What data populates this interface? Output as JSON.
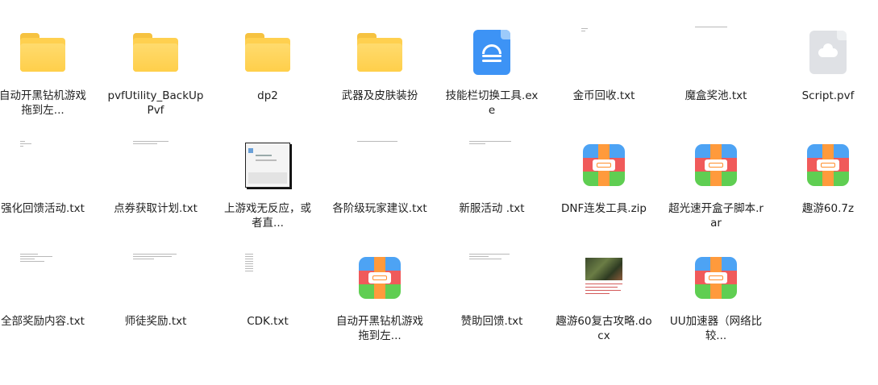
{
  "items": [
    {
      "name": "自动开黑钻机游戏拖到左...",
      "type": "folder"
    },
    {
      "name": "pvfUtility_BackUpPvf",
      "type": "folder"
    },
    {
      "name": "dp2",
      "type": "folder"
    },
    {
      "name": "武器及皮肤装扮",
      "type": "folder"
    },
    {
      "name": "技能栏切换工具.exe",
      "type": "exe"
    },
    {
      "name": "金币回收.txt",
      "type": "txt"
    },
    {
      "name": "魔盒奖池.txt",
      "type": "txt"
    },
    {
      "name": "Script.pvf",
      "type": "unknown"
    },
    {
      "name": "强化回馈活动.txt",
      "type": "txt"
    },
    {
      "name": "点券获取计划.txt",
      "type": "txt"
    },
    {
      "name": "上游戏无反应，或者直...",
      "type": "image"
    },
    {
      "name": "各阶级玩家建议.txt",
      "type": "txt"
    },
    {
      "name": "新服活动 .txt",
      "type": "txt"
    },
    {
      "name": "DNF连发工具.zip",
      "type": "archive"
    },
    {
      "name": "超光速开盒子脚本.rar",
      "type": "archive"
    },
    {
      "name": "趣游60.7z",
      "type": "archive"
    },
    {
      "name": "全部奖励内容.txt",
      "type": "txt"
    },
    {
      "name": "师徒奖励.txt",
      "type": "txt"
    },
    {
      "name": "CDK.txt",
      "type": "txt"
    },
    {
      "name": "自动开黑钻机游戏拖到左...",
      "type": "archive"
    },
    {
      "name": "赞助回馈.txt",
      "type": "txt"
    },
    {
      "name": "趣游60复古攻略.docx",
      "type": "docx"
    },
    {
      "name": "UU加速器（网络比较...",
      "type": "archive"
    }
  ]
}
